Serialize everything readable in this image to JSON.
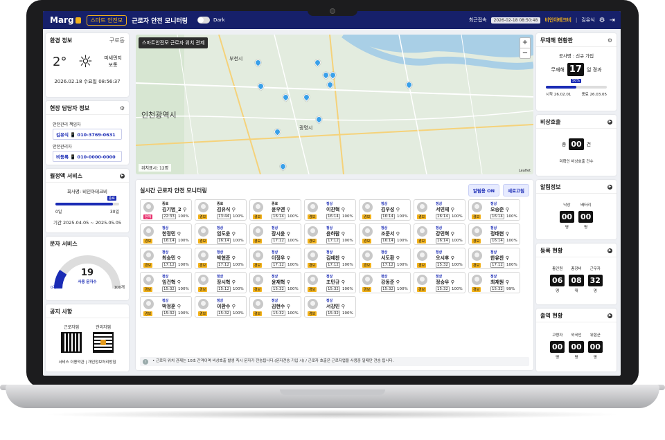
{
  "topbar": {
    "logo": "Marg",
    "app_badge": "스마트 안전모",
    "title": "근로자 안전 모니터링",
    "dark_label": "Dark",
    "last_access_label": "최근접속",
    "last_access_value": "2026-02-18 08:50:48",
    "company": "비인아테크비",
    "user": "김유식"
  },
  "env": {
    "title": "환경 정보",
    "region": "구로동",
    "temp": "2°",
    "dust_label": "미세먼지",
    "dust_value": "보통",
    "datetime": "2026.02.18 수요일 08:56:37"
  },
  "managers": {
    "title": "현장 담당자 정보",
    "chief_label": "안전관리 책임자",
    "chief": "김유식 📱 010-3769-0631",
    "manager_label": "안전관리자",
    "manager": "비등록 📱 010-0000-0000"
  },
  "monthly": {
    "title": "월정액 서비스",
    "company": "회사명: 비인아테크비",
    "tag": "종료",
    "min": "0일",
    "max": "30일",
    "progress": 0.9,
    "period": "기간 2025.04.05 ~ 2025.05.05"
  },
  "sms": {
    "title": "문자 서비스",
    "count": "19",
    "label": "사용 문자수",
    "min": "0개",
    "max": "100개",
    "ratio": 0.19
  },
  "notice_panel": {
    "title": "공지 사항",
    "qr1": "근로자앱",
    "qr2": "관리자앱",
    "links": "서비스 이용약관 | 개인정보처리방침"
  },
  "map": {
    "title": "스마트안전모 근로자 위치 관제",
    "count": "위치표시: 12명",
    "zoom_in": "+",
    "zoom_out": "−",
    "city1": "인천광역시",
    "city2": "부천시",
    "city3": "광명시",
    "attribution": "Leaflet"
  },
  "monitor": {
    "title": "실시간 근로자 안전 모니터링",
    "alarm_btn": "알림용 ON",
    "refresh_btn": "새로고침",
    "notice": "• 근로자 위치 관제는 10초 간격이며 비상호출 발생 즉시 문자가 전송됩니다.(문자전송 가입 시) / 근로자 호출은 근로자앱을 사용중 일때만 전송 됩니다.",
    "workers": [
      {
        "status": "종료",
        "name": "김기범_2",
        "tag": "현재",
        "time": "22:33",
        "bat": "100%",
        "dark": true,
        "red": true
      },
      {
        "status": "종료",
        "name": "김유식",
        "tag": "경보",
        "time": "13:44",
        "bat": "100%",
        "dark": true
      },
      {
        "status": "종료",
        "name": "윤우엔",
        "tag": "경보",
        "time": "16:14",
        "bat": "100%",
        "dark": true
      },
      {
        "status": "정상",
        "name": "이찬혁",
        "tag": "경보",
        "time": "16:14",
        "bat": "100%"
      },
      {
        "status": "정상",
        "name": "김우성",
        "tag": "경보",
        "time": "16:14",
        "bat": "100%"
      },
      {
        "status": "정상",
        "name": "서민재",
        "tag": "경보",
        "time": "16:14",
        "bat": "100%"
      },
      {
        "status": "정상",
        "name": "오승준",
        "tag": "경보",
        "time": "16:14",
        "bat": "100%"
      },
      {
        "status": "정상",
        "name": "한정민",
        "tag": "경보",
        "time": "16:14",
        "bat": "100%"
      },
      {
        "status": "정상",
        "name": "임도윤",
        "tag": "경보",
        "time": "16:14",
        "bat": "100%"
      },
      {
        "status": "정상",
        "name": "장시윤",
        "tag": "경보",
        "time": "17:12",
        "bat": "100%"
      },
      {
        "status": "정상",
        "name": "윤하람",
        "tag": "경보",
        "time": "17:12",
        "bat": "100%"
      },
      {
        "status": "정상",
        "name": "조준서",
        "tag": "경보",
        "time": "16:14",
        "bat": "100%"
      },
      {
        "status": "정상",
        "name": "강민혁",
        "tag": "경보",
        "time": "16:14",
        "bat": "100%"
      },
      {
        "status": "정상",
        "name": "정태현",
        "tag": "경보",
        "time": "16:14",
        "bat": "100%"
      },
      {
        "status": "정상",
        "name": "최승민",
        "tag": "경보",
        "time": "17:12",
        "bat": "100%"
      },
      {
        "status": "정상",
        "name": "박현준",
        "tag": "경보",
        "time": "17:12",
        "bat": "100%"
      },
      {
        "status": "정상",
        "name": "이정우",
        "tag": "경보",
        "time": "17:12",
        "bat": "100%"
      },
      {
        "status": "정상",
        "name": "김예찬",
        "tag": "경보",
        "time": "17:12",
        "bat": "100%"
      },
      {
        "status": "정상",
        "name": "서도환",
        "tag": "경보",
        "time": "17:12",
        "bat": "100%"
      },
      {
        "status": "정상",
        "name": "오시후",
        "tag": "경보",
        "time": "15:32",
        "bat": "100%"
      },
      {
        "status": "정상",
        "name": "한유찬",
        "tag": "경보",
        "time": "17:12",
        "bat": "100%"
      },
      {
        "status": "정상",
        "name": "임건혁",
        "tag": "경보",
        "time": "15:32",
        "bat": "100%"
      },
      {
        "status": "정상",
        "name": "장시혁",
        "tag": "경보",
        "time": "15:12",
        "bat": "100%"
      },
      {
        "status": "정상",
        "name": "윤재혁",
        "tag": "경보",
        "time": "15:32",
        "bat": "100%"
      },
      {
        "status": "정상",
        "name": "조민규",
        "tag": "경보",
        "time": "15:32",
        "bat": "100%"
      },
      {
        "status": "정상",
        "name": "강동준",
        "tag": "경보",
        "time": "15:32",
        "bat": "100%"
      },
      {
        "status": "정상",
        "name": "정승우",
        "tag": "경보",
        "time": "15:32",
        "bat": "100%"
      },
      {
        "status": "정상",
        "name": "최재원",
        "tag": "경보",
        "time": "15:32",
        "bat": "99%"
      },
      {
        "status": "정상",
        "name": "박정훈",
        "tag": "경보",
        "time": "15:32",
        "bat": "100%"
      },
      {
        "status": "정상",
        "name": "이환수",
        "tag": "경보",
        "time": "15:32",
        "bat": "100%"
      },
      {
        "status": "정상",
        "name": "김현수",
        "tag": "경보",
        "time": "15:32",
        "bat": "100%"
      },
      {
        "status": "정상",
        "name": "서강민",
        "tag": "경보",
        "time": "15:32",
        "bat": "100%"
      }
    ]
  },
  "accident_free": {
    "title": "무재해 현황판",
    "project": "공사명 : 신규 가입",
    "label": "무재해",
    "days": "17",
    "suffix": "일 경과",
    "percent_tag": "50%",
    "progress": 0.5,
    "start": "시작 26.02.01",
    "end": "종료 26.03.05"
  },
  "emergency": {
    "title": "비상호출",
    "prefix": "총",
    "count": "00",
    "suffix": "건",
    "note": "미확인 비상호출 건수"
  },
  "alerts": {
    "title": "알림정보",
    "items": [
      {
        "label": "낙상",
        "value": "00",
        "unit": "명"
      },
      {
        "label": "배터리",
        "value": "00",
        "unit": "명"
      }
    ]
  },
  "register": {
    "title": "등록 현황",
    "items": [
      {
        "label": "총인원",
        "value": "06",
        "unit": "명"
      },
      {
        "label": "총장비",
        "value": "08",
        "unit": "대"
      },
      {
        "label": "근무자",
        "value": "32",
        "unit": "명"
      }
    ]
  },
  "attendance": {
    "title": "출역 현황",
    "items": [
      {
        "label": "고령자",
        "value": "00",
        "unit": "명"
      },
      {
        "label": "외국인",
        "value": "00",
        "unit": "명"
      },
      {
        "label": "위험군",
        "value": "00",
        "unit": "명"
      }
    ]
  },
  "colors": {
    "primary": "#16206a",
    "accent": "#f3b21a",
    "blue": "#1a2bb5"
  }
}
